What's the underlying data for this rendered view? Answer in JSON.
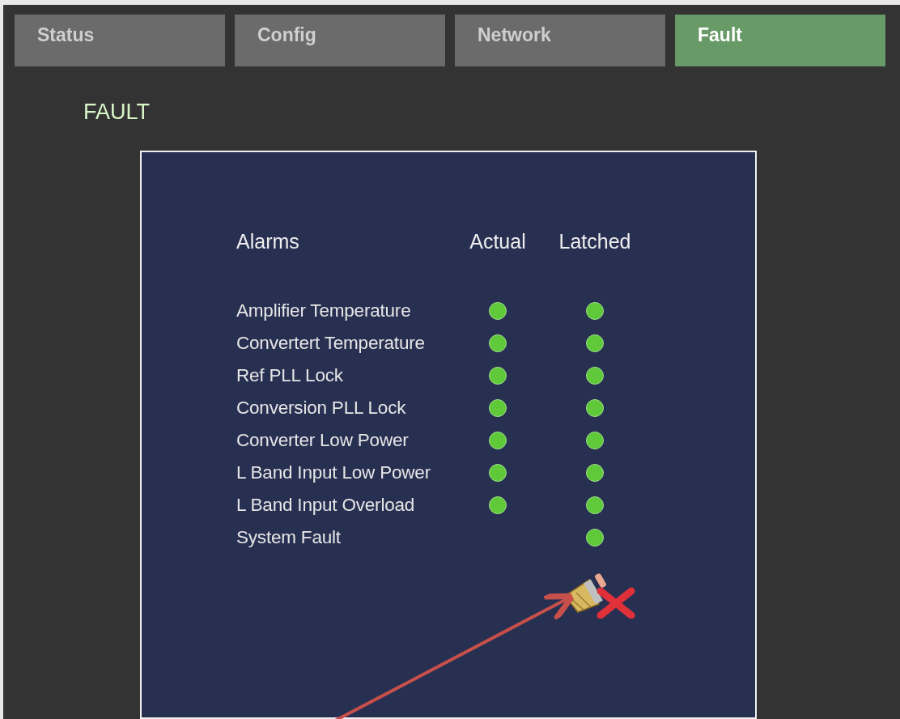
{
  "tabs": [
    {
      "label": "Status",
      "selected": false
    },
    {
      "label": "Config",
      "selected": false
    },
    {
      "label": "Network",
      "selected": false
    },
    {
      "label": "Fault",
      "selected": true
    }
  ],
  "heading": "FAULT",
  "alarm_table": {
    "columns": [
      "Alarms",
      "Actual",
      "Latched"
    ],
    "rows": [
      {
        "name": "Amplifier Temperature",
        "actual_fault": false,
        "latched_fault": false
      },
      {
        "name": "Convertert Temperature",
        "actual_fault": false,
        "latched_fault": false
      },
      {
        "name": "Ref PLL Lock",
        "actual_fault": false,
        "latched_fault": false
      },
      {
        "name": "Conversion PLL Lock",
        "actual_fault": false,
        "latched_fault": false
      },
      {
        "name": "Converter Low Power",
        "actual_fault": false,
        "latched_fault": false
      },
      {
        "name": "L Band Input Low Power",
        "actual_fault": false,
        "latched_fault": false
      },
      {
        "name": "L Band Input Overload",
        "actual_fault": false,
        "latched_fault": false
      },
      {
        "name": "System Fault",
        "latched_fault": false
      }
    ]
  }
}
